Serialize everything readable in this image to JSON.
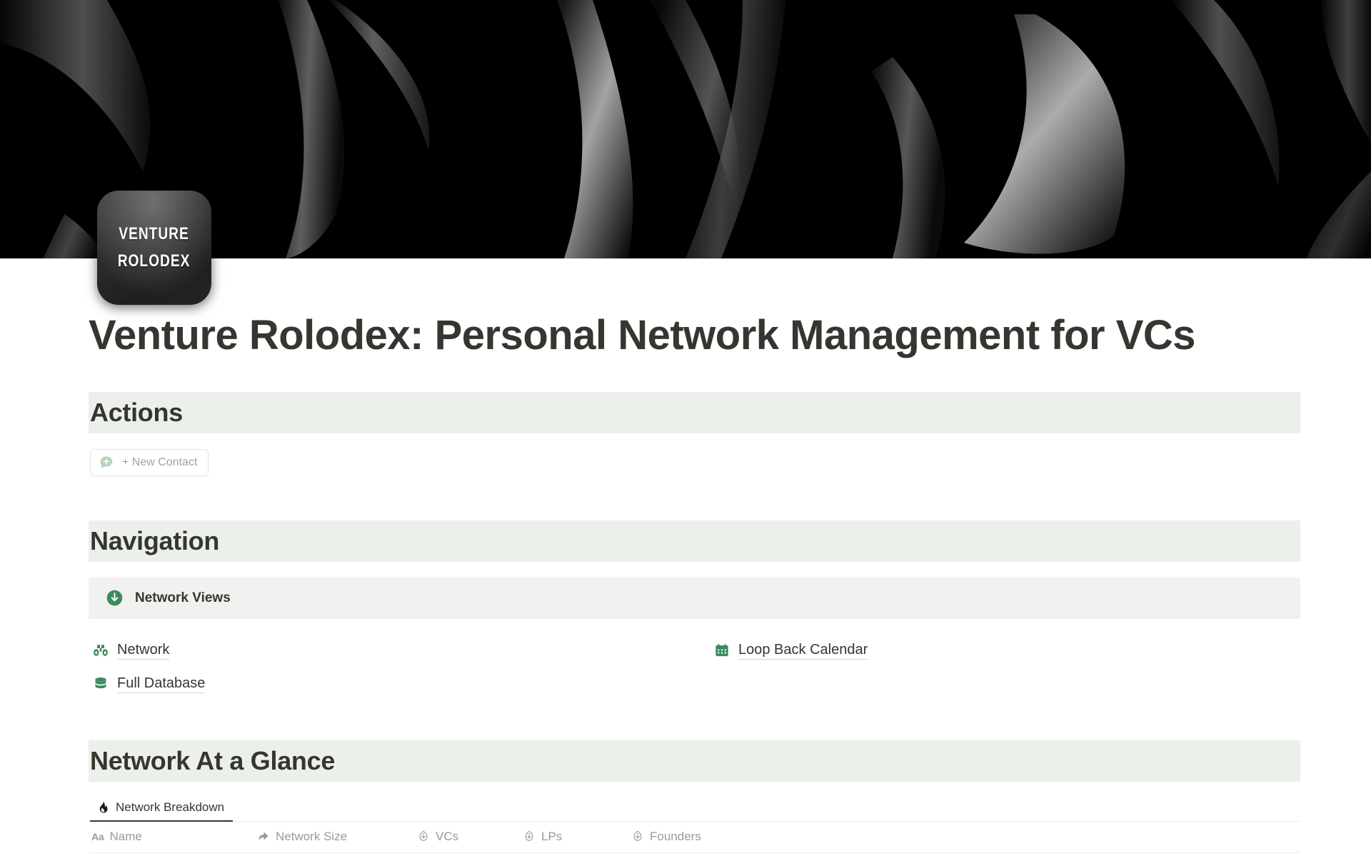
{
  "cover": {
    "alt_description": "abstract black and gray folded forms",
    "background_color": "#000000"
  },
  "page_icon": {
    "line1": "VENTURE",
    "line2": "ROLODEX"
  },
  "page_title": "Venture Rolodex: Personal Network Management for VCs",
  "theme": {
    "heading_banner_bg": "#ebf1ea",
    "toggle_row_bg": "#f1f1ef",
    "accent_green": "#3c8a5f",
    "text_primary": "#37352f",
    "text_muted": "#9b9a97"
  },
  "sections": {
    "actions": {
      "heading": "Actions",
      "new_contact_button": {
        "label": "+ New Contact",
        "icon": "speech-bubble-plus-icon"
      }
    },
    "navigation": {
      "heading": "Navigation",
      "toggle": {
        "label": "Network Views",
        "icon": "circle-down-arrow-icon"
      },
      "links": [
        {
          "label": "Network",
          "icon": "binoculars-icon"
        },
        {
          "label": "Loop Back Calendar",
          "icon": "calendar-icon"
        },
        {
          "label": "Full Database",
          "icon": "database-icon"
        }
      ]
    },
    "glance": {
      "heading": "Network At a Glance",
      "tabs": [
        {
          "label": "Network Breakdown",
          "icon": "flame-icon",
          "active": true
        }
      ],
      "table": {
        "columns": [
          {
            "label": "Name",
            "icon": "title-aa-icon"
          },
          {
            "label": "Network Size",
            "icon": "relation-arrow-icon"
          },
          {
            "label": "VCs",
            "icon": "rollup-icon"
          },
          {
            "label": "LPs",
            "icon": "rollup-icon"
          },
          {
            "label": "Founders",
            "icon": "rollup-icon"
          }
        ],
        "rows": []
      }
    }
  }
}
